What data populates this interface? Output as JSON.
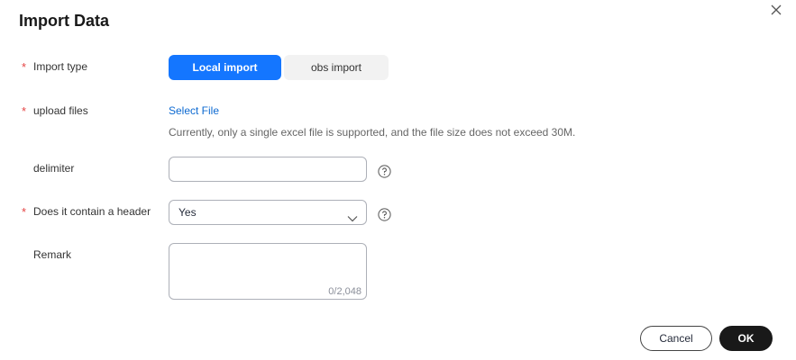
{
  "dialog": {
    "title": "Import Data",
    "close_icon": "close-icon"
  },
  "form": {
    "required_mark": "*",
    "import_type": {
      "label": "Import type",
      "options": [
        "Local import",
        "obs import"
      ],
      "selected": "Local import"
    },
    "upload_files": {
      "label": "upload files",
      "link": "Select File",
      "help": "Currently, only a single excel file is supported, and the file size does not exceed 30M."
    },
    "delimiter": {
      "label": "delimiter",
      "value": "",
      "help_icon": "question-circle-icon"
    },
    "header": {
      "label": "Does it contain a header",
      "value": "Yes",
      "help_icon": "question-circle-icon"
    },
    "remark": {
      "label": "Remark",
      "value": "",
      "counter": "0/2,048"
    }
  },
  "footer": {
    "cancel_label": "Cancel",
    "ok_label": "OK"
  },
  "colors": {
    "accent": "#1476ff",
    "required": "#e54545",
    "link": "#0d6ad1",
    "primary_button": "#191919"
  }
}
